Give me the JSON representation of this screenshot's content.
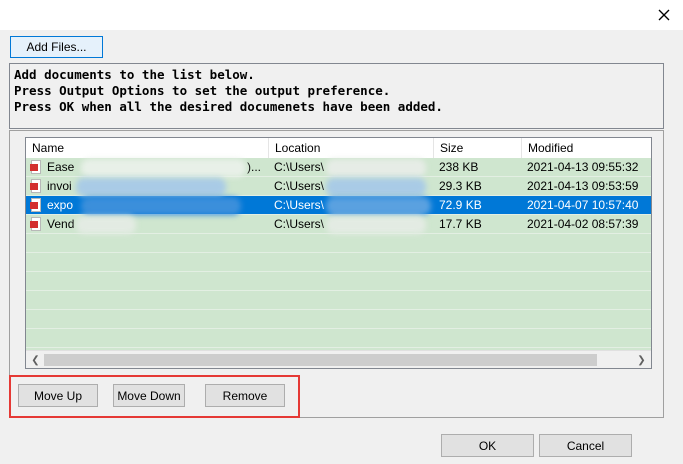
{
  "toolbar": {
    "add_files_label": "Add Files..."
  },
  "instructions": {
    "lines": [
      "Add documents to the list below.",
      "Press Output Options to set the output preference.",
      "Press OK when all the desired documenets have been added."
    ]
  },
  "table": {
    "columns": [
      "Name",
      "Location",
      "Size",
      "Modified"
    ],
    "rows": [
      {
        "name": "Ease",
        "name_suffix": ")...",
        "location": "C:\\Users\\",
        "size": "238 KB",
        "modified": "2021-04-13 09:55:32",
        "icon": "pdf-file-icon",
        "selected": false
      },
      {
        "name": "invoi",
        "name_suffix": "",
        "location": "C:\\Users\\",
        "size": "29.3 KB",
        "modified": "2021-04-13 09:53:59",
        "icon": "pdf-file-icon",
        "selected": false
      },
      {
        "name": "expo",
        "name_suffix": "",
        "location": "C:\\Users\\",
        "size": "72.9 KB",
        "modified": "2021-04-07 10:57:40",
        "icon": "pdf-file-icon",
        "selected": true
      },
      {
        "name": "Vend",
        "name_suffix": "",
        "location": "C:\\Users\\",
        "size": "17.7 KB",
        "modified": "2021-04-02 08:57:39",
        "icon": "pdf-file-icon",
        "selected": false
      }
    ]
  },
  "list_actions": {
    "move_up_label": "Move Up",
    "move_down_label": "Move Down",
    "remove_label": "Remove"
  },
  "dialog_buttons": {
    "ok_label": "OK",
    "cancel_label": "Cancel"
  },
  "colors": {
    "row_background": "#cfe6cf",
    "selected_row": "#0078d7",
    "highlight_border": "#e53935",
    "pdf_icon": "#d32f2f"
  }
}
